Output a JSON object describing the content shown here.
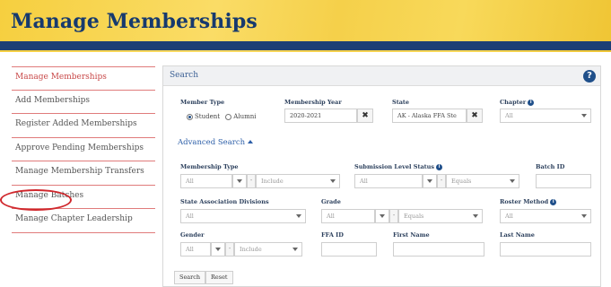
{
  "header": {
    "title": "Manage Memberships"
  },
  "sidebar": {
    "items": [
      {
        "label": "Manage Memberships"
      },
      {
        "label": "Add Memberships"
      },
      {
        "label": "Register Added Memberships"
      },
      {
        "label": "Approve Pending Memberships"
      },
      {
        "label": "Manage Membership Transfers"
      },
      {
        "label": "Manage Batches"
      },
      {
        "label": "Manage Chapter Leadership"
      }
    ]
  },
  "search": {
    "title": "Search",
    "help_icon": "?",
    "member_type": {
      "label": "Member Type",
      "options": [
        "Student",
        "Alumni"
      ],
      "selected": "Student"
    },
    "membership_year": {
      "label": "Membership Year",
      "value": "2020-2021"
    },
    "state": {
      "label": "State",
      "value": "AK - Alaska FFA Ste"
    },
    "chapter": {
      "label": "Chapter",
      "value": "All"
    },
    "advanced_label": "Advanced Search",
    "membership_type": {
      "label": "Membership Type",
      "value": "All",
      "operator": "Include"
    },
    "submission_status": {
      "label": "Submission Level Status",
      "value": "All",
      "operator": "Equals"
    },
    "batch_id": {
      "label": "Batch ID",
      "value": ""
    },
    "state_divisions": {
      "label": "State Association Divisions",
      "value": "All"
    },
    "grade": {
      "label": "Grade",
      "value": "All",
      "operator": "Equals"
    },
    "roster_method": {
      "label": "Roster Method",
      "value": "All"
    },
    "gender": {
      "label": "Gender",
      "value": "All",
      "operator": "Include"
    },
    "ffa_id": {
      "label": "FFA ID",
      "value": ""
    },
    "first_name": {
      "label": "First Name",
      "value": ""
    },
    "last_name": {
      "label": "Last Name",
      "value": ""
    },
    "search_button": "Search",
    "reset_button": "Reset",
    "dash": "-",
    "clear_glyph": "✖"
  },
  "colors": {
    "banner_yellow": "#f6cf3f",
    "banner_blue": "#1c3f75",
    "accent_red": "#d0282d",
    "link_blue": "#2d5fa8"
  }
}
